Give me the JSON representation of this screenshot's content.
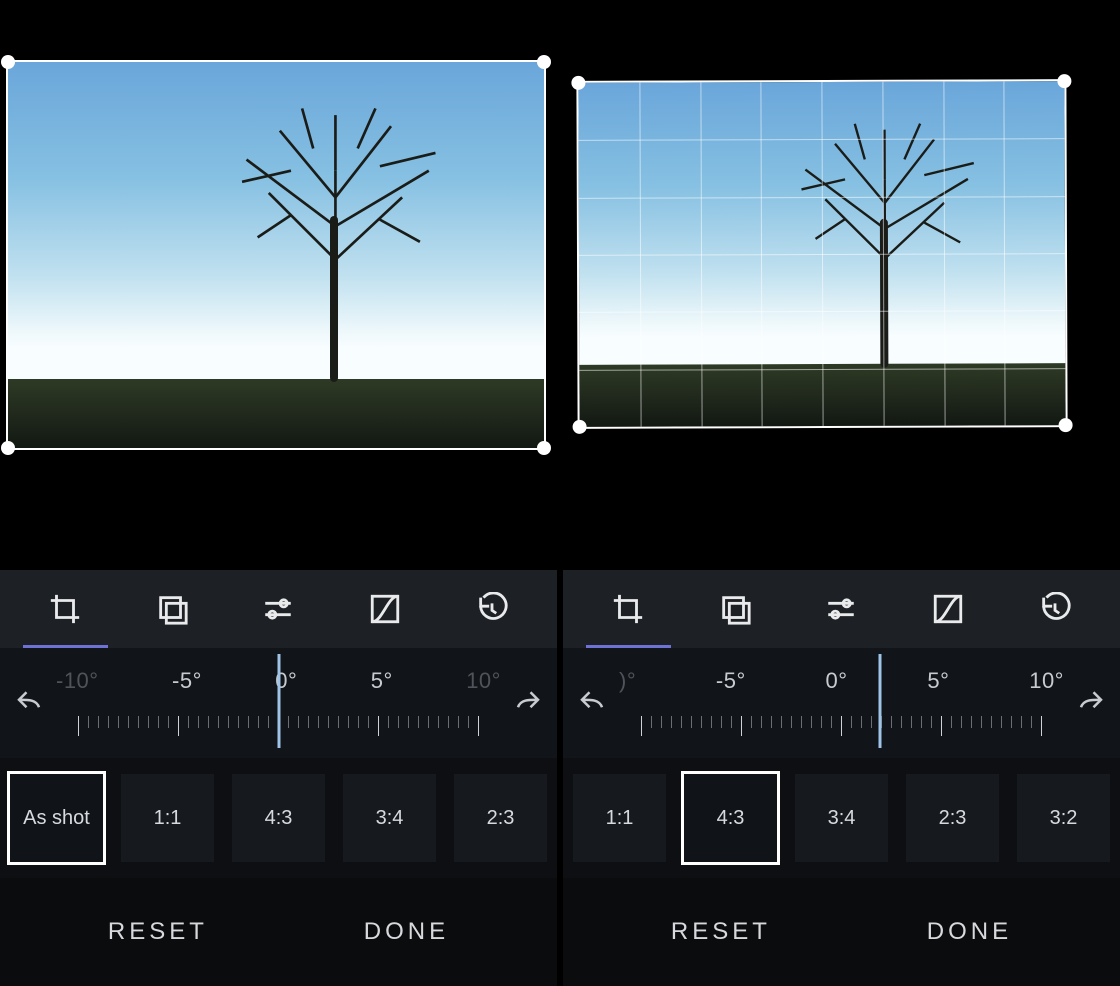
{
  "tool_tabs": [
    {
      "name": "crop-tab",
      "icon": "crop",
      "active": true
    },
    {
      "name": "filters-tab",
      "icon": "layers",
      "active": false
    },
    {
      "name": "adjust-tab",
      "icon": "sliders",
      "active": false
    },
    {
      "name": "curves-tab",
      "icon": "curve",
      "active": false
    },
    {
      "name": "history-tab",
      "icon": "history",
      "active": false
    }
  ],
  "rotation_ruler": {
    "labels": [
      "-10°",
      "-5°",
      "0°",
      "5°",
      "10°"
    ],
    "left_current": "0°",
    "right_current": "2°"
  },
  "left_panel": {
    "aspects": [
      {
        "label": "As shot",
        "selected": true
      },
      {
        "label": "1:1",
        "selected": false
      },
      {
        "label": "4:3",
        "selected": false
      },
      {
        "label": "3:4",
        "selected": false
      },
      {
        "label": "2:3",
        "selected": false
      }
    ]
  },
  "right_panel": {
    "aspects": [
      {
        "label": "1:1",
        "selected": false
      },
      {
        "label": "4:3",
        "selected": true
      },
      {
        "label": "3:4",
        "selected": false
      },
      {
        "label": "2:3",
        "selected": false
      },
      {
        "label": "3:2",
        "selected": false
      }
    ]
  },
  "footer": {
    "reset": "RESET",
    "done": "DONE"
  }
}
